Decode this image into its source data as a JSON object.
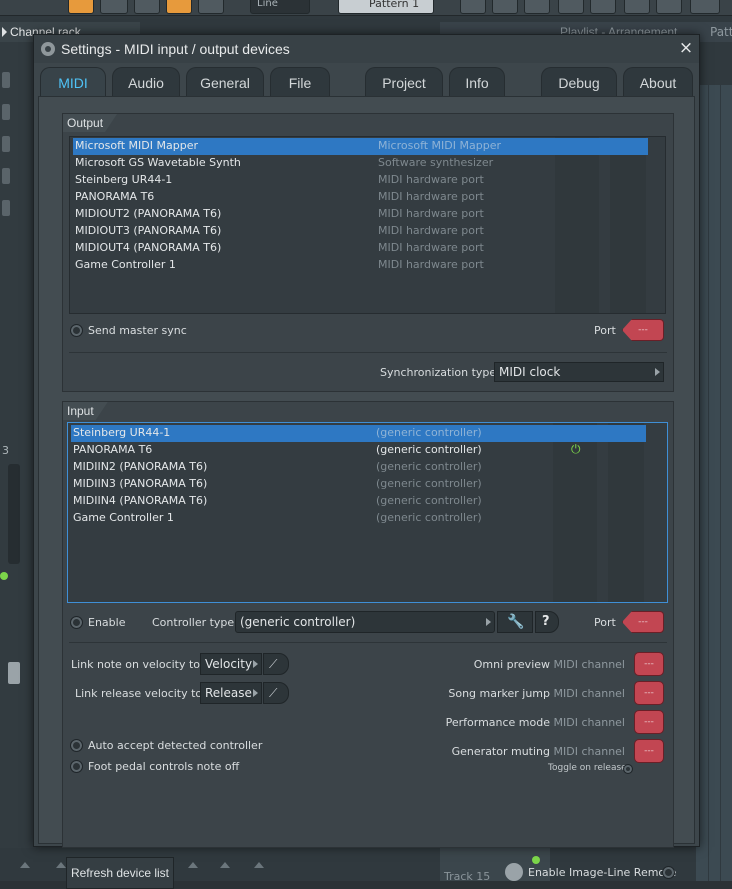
{
  "background": {
    "channel_rack_title": "Channel rack",
    "playlist_title": "Playlist - Arrangement",
    "playlist_suffix": "Patt",
    "pattern_label": "Pattern 1",
    "line_label": "Line",
    "left_indicator": "3",
    "track_label": "Track 15"
  },
  "dialog": {
    "title": "Settings - MIDI input / output devices",
    "close_glyph": "×",
    "tabs": [
      {
        "label": "MIDI",
        "active": true
      },
      {
        "label": "Audio",
        "active": false
      },
      {
        "label": "General",
        "active": false
      },
      {
        "label": "File",
        "active": false
      },
      {
        "label": "Project",
        "active": false
      },
      {
        "label": "Info",
        "active": false
      },
      {
        "label": "Debug",
        "active": false
      },
      {
        "label": "About",
        "active": false
      }
    ],
    "output": {
      "section_label": "Output",
      "devices": [
        {
          "name": "Microsoft MIDI Mapper",
          "type": "Microsoft MIDI Mapper",
          "selected": true
        },
        {
          "name": "Microsoft GS Wavetable Synth",
          "type": "Software synthesizer",
          "selected": false
        },
        {
          "name": "Steinberg UR44-1",
          "type": "MIDI hardware port",
          "selected": false
        },
        {
          "name": "PANORAMA T6",
          "type": "MIDI hardware port",
          "selected": false
        },
        {
          "name": "MIDIOUT2 (PANORAMA T6)",
          "type": "MIDI hardware port",
          "selected": false
        },
        {
          "name": "MIDIOUT3 (PANORAMA T6)",
          "type": "MIDI hardware port",
          "selected": false
        },
        {
          "name": "MIDIOUT4 (PANORAMA T6)",
          "type": "MIDI hardware port",
          "selected": false
        },
        {
          "name": "Game Controller 1",
          "type": "MIDI hardware port",
          "selected": false
        }
      ],
      "send_master_sync_label": "Send master sync",
      "port_label": "Port",
      "port_value": "---",
      "sync_type_label": "Synchronization type",
      "sync_type_value": "MIDI clock"
    },
    "input": {
      "section_label": "Input",
      "devices": [
        {
          "name": "Steinberg UR44-1",
          "type": "(generic controller)",
          "selected": true,
          "enabled": false
        },
        {
          "name": "PANORAMA T6",
          "type": "(generic controller)",
          "selected": false,
          "enabled": true
        },
        {
          "name": "MIDIIN2 (PANORAMA T6)",
          "type": "(generic controller)",
          "selected": false,
          "enabled": false
        },
        {
          "name": "MIDIIN3 (PANORAMA T6)",
          "type": "(generic controller)",
          "selected": false,
          "enabled": false
        },
        {
          "name": "MIDIIN4 (PANORAMA T6)",
          "type": "(generic controller)",
          "selected": false,
          "enabled": false
        },
        {
          "name": "Game Controller 1",
          "type": "(generic controller)",
          "selected": false,
          "enabled": false
        }
      ],
      "enable_label": "Enable",
      "controller_type_label": "Controller type",
      "controller_type_value": "(generic controller)",
      "help_glyph": "?",
      "port_label": "Port",
      "port_value": "---",
      "link_note_velocity_label": "Link note on velocity to",
      "link_note_velocity_value": "Velocity",
      "link_release_velocity_label": "Link release velocity to",
      "link_release_velocity_value": "Release",
      "auto_accept_label": "Auto accept detected controller",
      "foot_pedal_label": "Foot pedal controls note off",
      "channels": [
        {
          "label": "Omni preview",
          "suffix": "MIDI channel",
          "value": "---"
        },
        {
          "label": "Song marker jump",
          "suffix": "MIDI channel",
          "value": "---"
        },
        {
          "label": "Performance mode",
          "suffix": "MIDI channel",
          "value": "---"
        },
        {
          "label": "Generator muting",
          "suffix": "MIDI channel",
          "value": "---"
        }
      ],
      "toggle_on_release_label": "Toggle on release"
    },
    "refresh_button_label": "Refresh device list",
    "enable_remote_label": "Enable Image-Line Remote"
  },
  "colors": {
    "accent": "#4fc3f7",
    "selection": "#2e78c3",
    "port_knob": "#c24652",
    "enabled_led": "#7cd64a"
  }
}
